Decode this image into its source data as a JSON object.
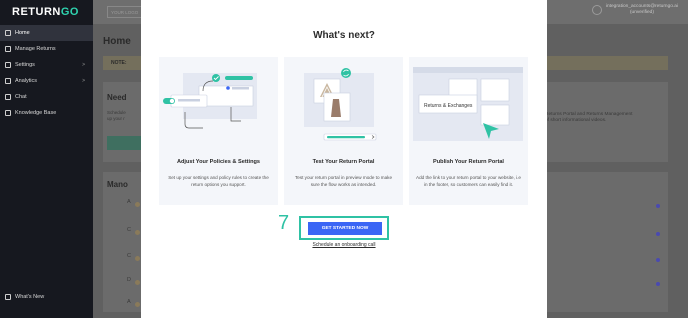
{
  "sidebar": {
    "logo_main": "RETURN",
    "logo_accent": "GO",
    "items": [
      {
        "label": "Home",
        "caret": ""
      },
      {
        "label": "Manage Returns",
        "caret": ""
      },
      {
        "label": "Settings",
        "caret": ">"
      },
      {
        "label": "Analytics",
        "caret": ">"
      },
      {
        "label": "Chat",
        "caret": ""
      },
      {
        "label": "Knowledge Base",
        "caret": ""
      }
    ],
    "whats_new": "What's New"
  },
  "topbar": {
    "logo_placeholder": "YOUR LOGO",
    "account_email": "integration_accounts@returngo.ai",
    "account_status": "(unverified)"
  },
  "background": {
    "page_title": "Home",
    "note_label": "NOTE:",
    "need_title": "Need",
    "sched_line1": "Schedule",
    "sched_line2": "up your r",
    "right_line1": "Returns Portal and Returns Management",
    "right_line2": "of short informational videos.",
    "manage_title": "Mano",
    "row_letters": [
      "A",
      "C",
      "C",
      "D",
      "A"
    ]
  },
  "modal": {
    "title": "What's next?",
    "steps": [
      {
        "title": "Adjust Your Policies & Settings",
        "desc": "Set up your settings and policy rules to create the return options you support."
      },
      {
        "title": "Test Your Return Portal",
        "desc": "Test your return portal in preview mode to make sure the flow works as intended."
      },
      {
        "title": "Publish Your Return Portal",
        "desc": "Add the link to your return portal to your website, i.e in the footer, so customers can easily find it."
      }
    ],
    "illus_label": "Returns & Exchanges",
    "cta_label": "GET STARTED NOW",
    "annotation_number": "7",
    "schedule_link": "Schedule an onboarding call"
  },
  "colors": {
    "accent_teal": "#2fc2a4",
    "cta_blue": "#3b66f5",
    "sidebar_bg": "#16181f"
  }
}
